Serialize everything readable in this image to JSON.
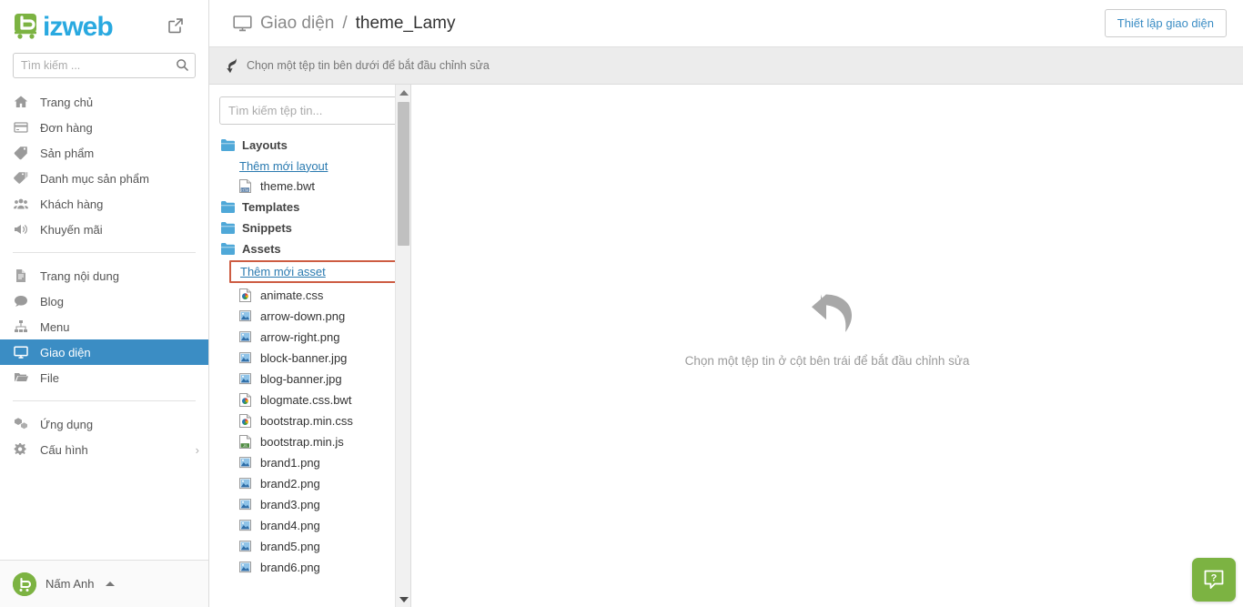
{
  "brand": {
    "logo_text": "izweb",
    "logo_mark": "b-cart-logo",
    "logo_color": "#29a9e0",
    "logo_mark_color": "#7cb342"
  },
  "sidebar": {
    "search": {
      "placeholder": "Tìm kiếm ...",
      "value": ""
    },
    "groups": [
      {
        "items": [
          {
            "label": "Trang chủ",
            "icon": "home-icon",
            "active": false
          },
          {
            "label": "Đơn hàng",
            "icon": "orders-icon",
            "active": false
          },
          {
            "label": "Sản phẩm",
            "icon": "tag-icon",
            "active": false
          },
          {
            "label": "Danh mục sản phẩm",
            "icon": "tags-icon",
            "active": false
          },
          {
            "label": "Khách hàng",
            "icon": "customers-icon",
            "active": false
          },
          {
            "label": "Khuyến mãi",
            "icon": "megaphone-icon",
            "active": false
          }
        ]
      },
      {
        "items": [
          {
            "label": "Trang nội dung",
            "icon": "page-icon",
            "active": false
          },
          {
            "label": "Blog",
            "icon": "comment-icon",
            "active": false
          },
          {
            "label": "Menu",
            "icon": "sitemap-icon",
            "active": false
          },
          {
            "label": "Giao diện",
            "icon": "monitor-icon",
            "active": true
          },
          {
            "label": "File",
            "icon": "folder-open-icon",
            "active": false
          }
        ]
      },
      {
        "items": [
          {
            "label": "Ứng dụng",
            "icon": "apps-icon",
            "active": false
          },
          {
            "label": "Cấu hình",
            "icon": "gears-icon",
            "active": false,
            "caret": "›"
          }
        ]
      }
    ],
    "active_color": "#3b8dc4",
    "user": {
      "name": "Nấm Anh",
      "caret": "▲"
    }
  },
  "topbar": {
    "breadcrumb": {
      "icon": "monitor-icon",
      "parent": "Giao diện",
      "separator": "/",
      "current": "theme_Lamy"
    },
    "settings_button": "Thiết lập giao diện"
  },
  "notice": {
    "icon": "curved-arrow-down-icon",
    "text": "Chọn một tệp tin bên dưới để bắt đầu chỉnh sửa"
  },
  "filetree": {
    "search": {
      "placeholder": "Tìm kiếm tệp tin...",
      "value": ""
    },
    "nodes": [
      {
        "type": "folder",
        "label": "Layouts",
        "icon": "folder-icon"
      },
      {
        "type": "link",
        "label": "Thêm mới layout",
        "icon": "add-link"
      },
      {
        "type": "file",
        "label": "theme.bwt",
        "icon": "html-file-icon"
      },
      {
        "type": "folder",
        "label": "Templates",
        "icon": "folder-icon"
      },
      {
        "type": "folder",
        "label": "Snippets",
        "icon": "folder-icon"
      },
      {
        "type": "folder",
        "label": "Assets",
        "icon": "folder-icon"
      },
      {
        "type": "link-highlighted",
        "label": "Thêm mới asset",
        "icon": "add-link",
        "highlight_color": "#cd5c42"
      },
      {
        "type": "file",
        "label": "animate.css",
        "icon": "css-file-icon"
      },
      {
        "type": "file",
        "label": "arrow-down.png",
        "icon": "image-file-icon"
      },
      {
        "type": "file",
        "label": "arrow-right.png",
        "icon": "image-file-icon"
      },
      {
        "type": "file",
        "label": "block-banner.jpg",
        "icon": "image-file-icon"
      },
      {
        "type": "file",
        "label": "blog-banner.jpg",
        "icon": "image-file-icon"
      },
      {
        "type": "file",
        "label": "blogmate.css.bwt",
        "icon": "css-file-icon"
      },
      {
        "type": "file",
        "label": "bootstrap.min.css",
        "icon": "css-file-icon"
      },
      {
        "type": "file",
        "label": "bootstrap.min.js",
        "icon": "js-file-icon"
      },
      {
        "type": "file",
        "label": "brand1.png",
        "icon": "image-file-icon"
      },
      {
        "type": "file",
        "label": "brand2.png",
        "icon": "image-file-icon"
      },
      {
        "type": "file",
        "label": "brand3.png",
        "icon": "image-file-icon"
      },
      {
        "type": "file",
        "label": "brand4.png",
        "icon": "image-file-icon"
      },
      {
        "type": "file",
        "label": "brand5.png",
        "icon": "image-file-icon"
      },
      {
        "type": "file",
        "label": "brand6.png",
        "icon": "image-file-icon"
      }
    ],
    "scrollbar": {
      "up_arrow": "▲",
      "down_arrow": "▼"
    }
  },
  "editor_empty": {
    "icon": "curved-back-arrow-icon",
    "text": "Chọn một tệp tin ở cột bên trái để bắt đầu chỉnh sửa"
  },
  "help": {
    "icon": "question-bubble-icon",
    "label": "?",
    "color": "#7cb342"
  }
}
